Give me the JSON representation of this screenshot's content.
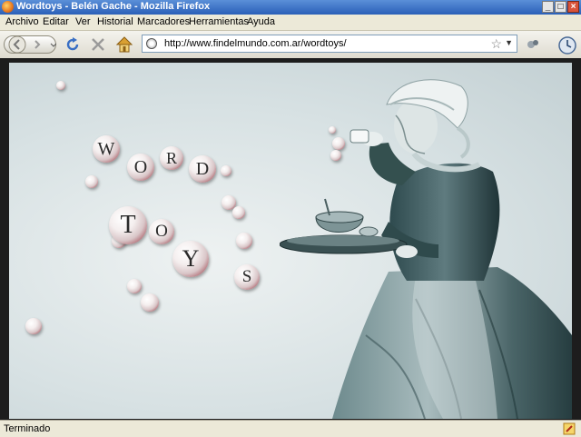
{
  "window": {
    "title": "Wordtoys - Belén Gache - Mozilla Firefox"
  },
  "menu": [
    "Archivo",
    "Editar",
    "Ver",
    "Historial",
    "Marcadores",
    "Herramientas",
    "Ayuda"
  ],
  "navigation": {
    "url": "http://www.findelmundo.com.ar/wordtoys/"
  },
  "page": {
    "letters": [
      "W",
      "O",
      "R",
      "D",
      "T",
      "O",
      "Y",
      "S"
    ]
  },
  "status": {
    "text": "Terminado"
  }
}
